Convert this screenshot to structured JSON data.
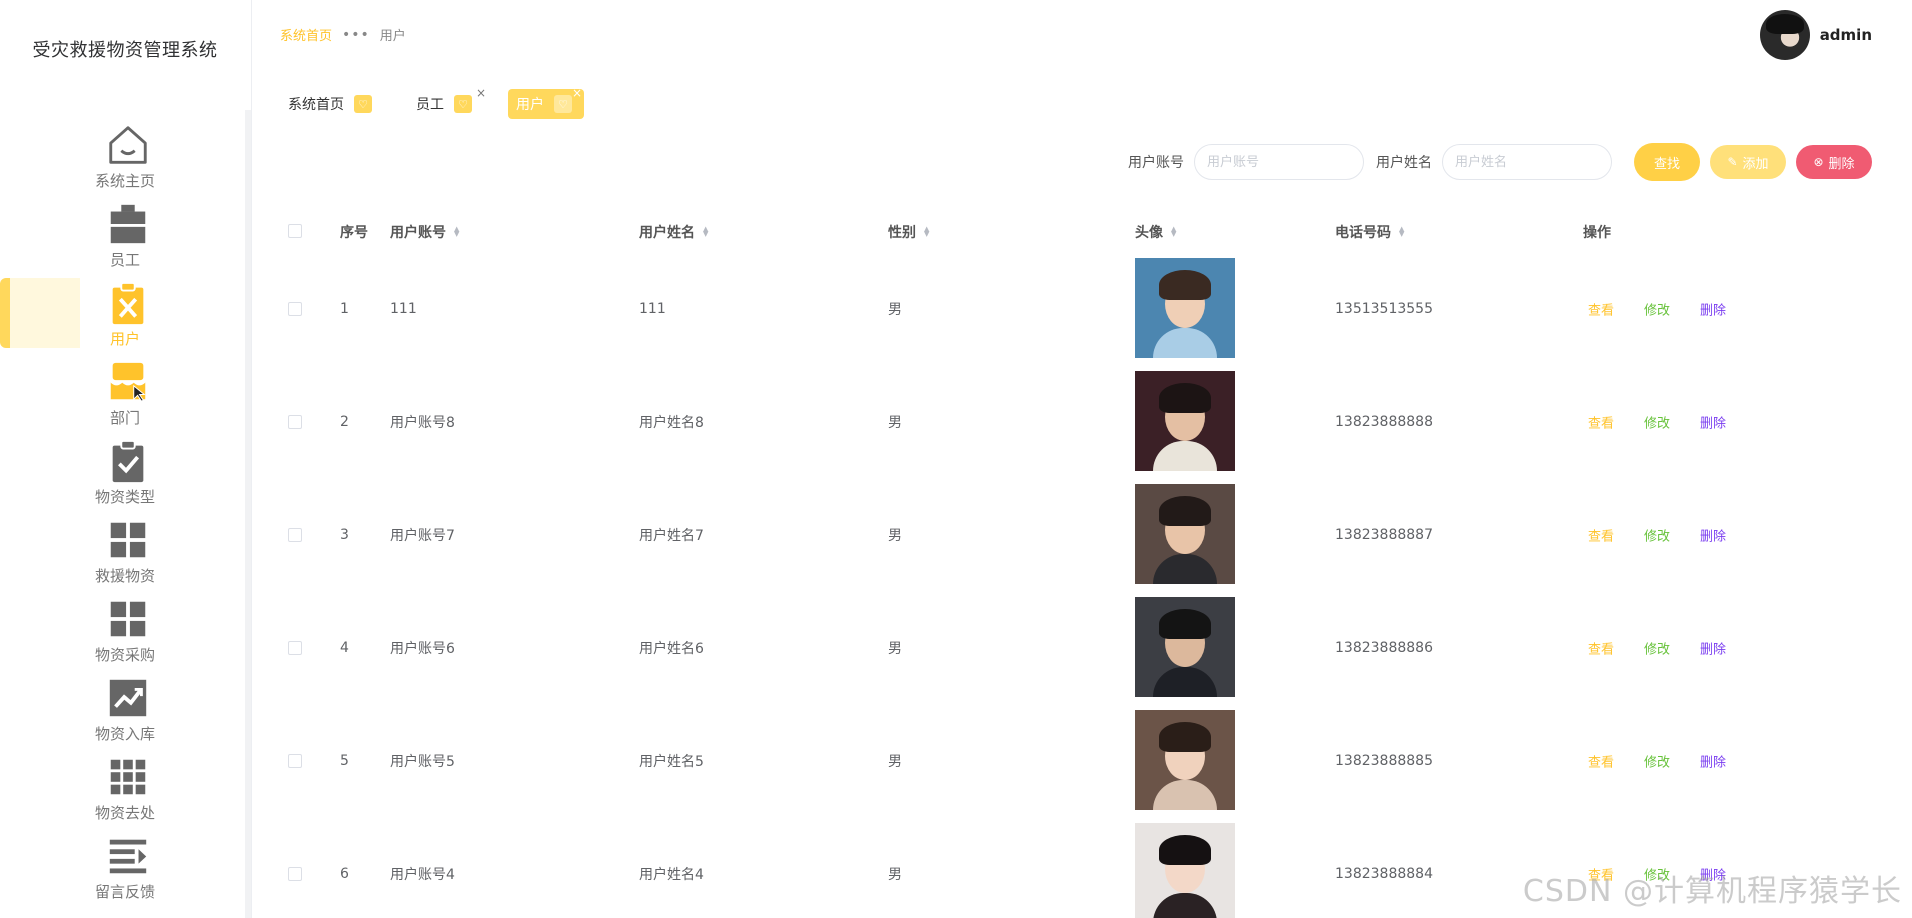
{
  "app_title": "受灾救援物资管理系统",
  "sidebar": {
    "items": [
      {
        "label": "系统主页",
        "icon": "home-icon"
      },
      {
        "label": "员工",
        "icon": "briefcase-icon"
      },
      {
        "label": "用户",
        "icon": "clipboard-x-icon",
        "active": true
      },
      {
        "label": "部门",
        "icon": "store-icon"
      },
      {
        "label": "物资类型",
        "icon": "clipboard-check-icon"
      },
      {
        "label": "救援物资",
        "icon": "grid-icon"
      },
      {
        "label": "物资采购",
        "icon": "grid-icon"
      },
      {
        "label": "物资入库",
        "icon": "trend-chart-icon"
      },
      {
        "label": "物资去处",
        "icon": "apps-grid-icon"
      },
      {
        "label": "留言反馈",
        "icon": "list-indent-icon"
      }
    ]
  },
  "header": {
    "breadcrumb": {
      "home": "系统首页",
      "separator": "•••",
      "current": "用户"
    },
    "username": "admin"
  },
  "tabs": [
    {
      "label": "系统首页",
      "closable": false
    },
    {
      "label": "员工",
      "closable": true
    },
    {
      "label": "用户",
      "closable": true,
      "active": true
    }
  ],
  "search": {
    "account_label": "用户账号",
    "account_placeholder": "用户账号",
    "name_label": "用户姓名",
    "name_placeholder": "用户姓名",
    "find_label": "查找",
    "add_label": "添加",
    "delete_label": "删除"
  },
  "table": {
    "headers": {
      "index": "序号",
      "account": "用户账号",
      "name": "用户姓名",
      "gender": "性别",
      "avatar": "头像",
      "phone": "电话号码",
      "actions": "操作"
    },
    "action_labels": {
      "view": "查看",
      "edit": "修改",
      "delete": "删除"
    },
    "rows": [
      {
        "index": "1",
        "account": "111",
        "name": "111",
        "gender": "男",
        "phone": "13513513555",
        "photo": {
          "bg": "#4c86b0",
          "hair": "#3a2a22",
          "face": "#efcfb6",
          "body": "#a9cde6"
        }
      },
      {
        "index": "2",
        "account": "用户账号8",
        "name": "用户姓名8",
        "gender": "男",
        "phone": "13823888888",
        "photo": {
          "bg": "#3b2026",
          "hair": "#1c1414",
          "face": "#e4bfa3",
          "body": "#e9e4da"
        }
      },
      {
        "index": "3",
        "account": "用户账号7",
        "name": "用户姓名7",
        "gender": "男",
        "phone": "13823888887",
        "photo": {
          "bg": "#5a4a44",
          "hair": "#221a18",
          "face": "#e8c4a8",
          "body": "#2a2a2e"
        }
      },
      {
        "index": "4",
        "account": "用户账号6",
        "name": "用户姓名6",
        "gender": "男",
        "phone": "13823888886",
        "photo": {
          "bg": "#3c3e44",
          "hair": "#141414",
          "face": "#dcb89c",
          "body": "#1e2026"
        }
      },
      {
        "index": "5",
        "account": "用户账号5",
        "name": "用户姓名5",
        "gender": "男",
        "phone": "13823888885",
        "photo": {
          "bg": "#6b5448",
          "hair": "#2a1e18",
          "face": "#f0d2bd",
          "body": "#d9c2b0"
        }
      },
      {
        "index": "6",
        "account": "用户账号4",
        "name": "用户姓名4",
        "gender": "男",
        "phone": "13823888884",
        "photo": {
          "bg": "#e8e4e2",
          "hair": "#151112",
          "face": "#f3d8c8",
          "body": "#2a2224"
        }
      }
    ]
  },
  "watermark": "CSDN @计算机程序猿学长",
  "colors": {
    "accent": "#ffd046",
    "active_text": "#ffc32b",
    "danger": "#f05b72",
    "edit": "#67c23a",
    "delete_link": "#7a3df0"
  }
}
